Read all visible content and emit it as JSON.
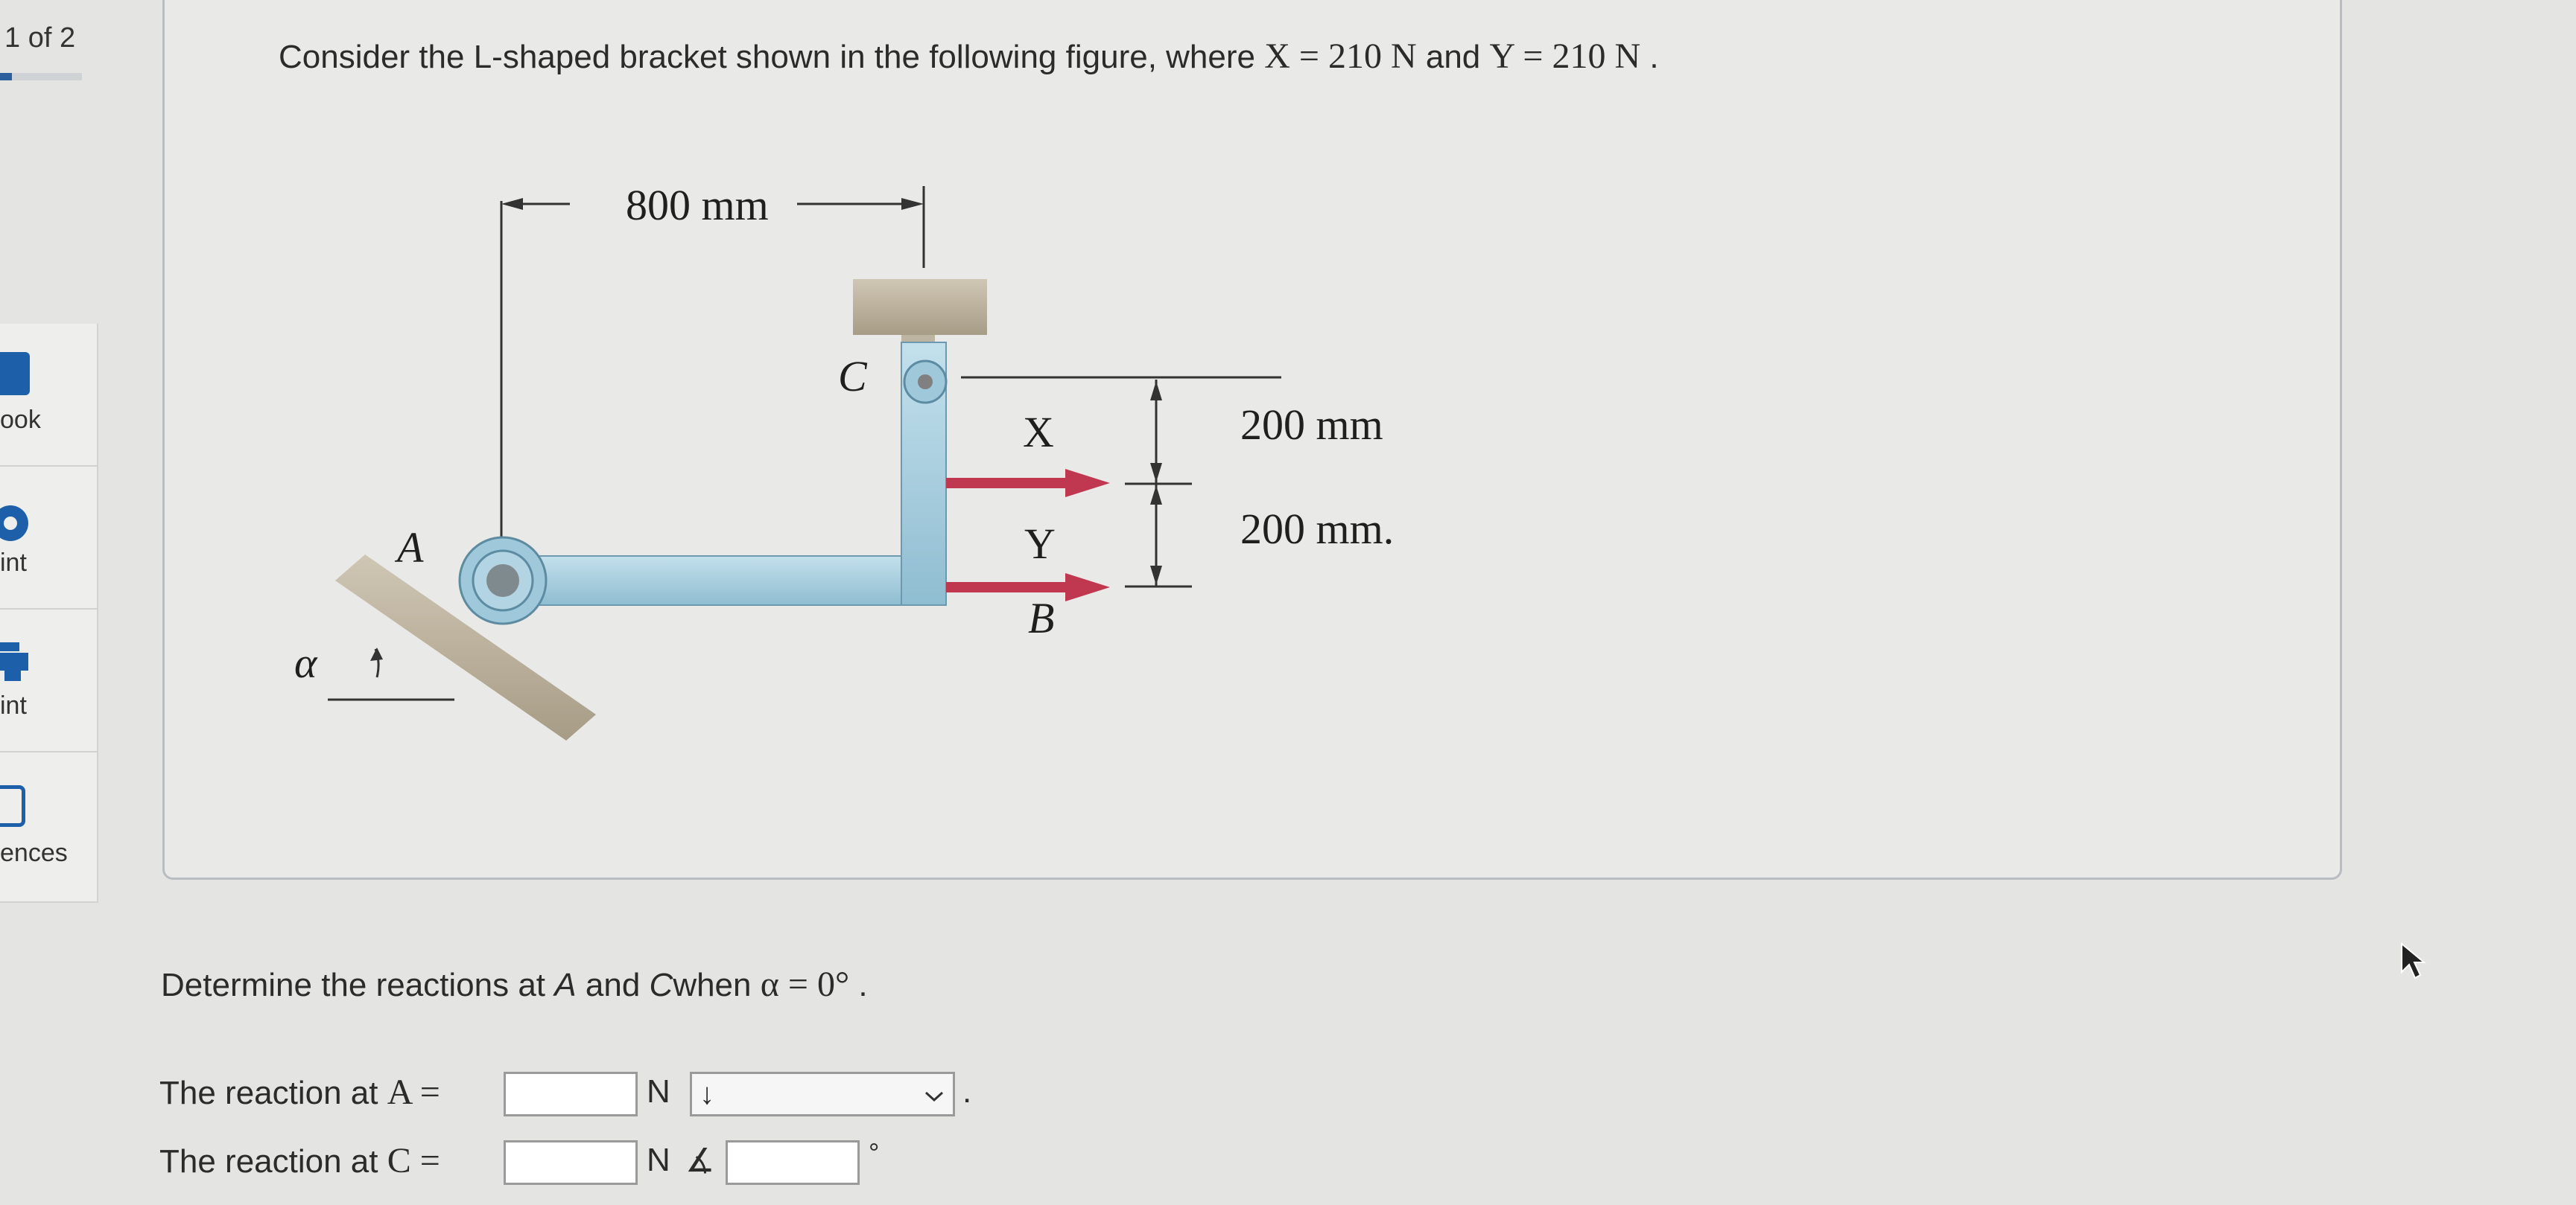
{
  "sidebar": {
    "page_count": "1 of 2",
    "items": [
      {
        "label": "ook",
        "icon": "book-icon"
      },
      {
        "label": "int",
        "icon": "hint-icon"
      },
      {
        "label": "int",
        "icon": "print-icon"
      },
      {
        "label": "ences",
        "icon": "references-icon"
      }
    ]
  },
  "question": {
    "intro": "Consider the L-shaped bracket shown in the following figure, where",
    "x_expr": "X = 210 N",
    "and": "and",
    "y_expr": "Y = 210 N",
    "period": "."
  },
  "figure": {
    "dim_top": "800 mm",
    "dim_upper": "200 mm",
    "dim_lower": "200 mm",
    "dim_lower_period": ".",
    "label_A": "A",
    "label_B": "B",
    "label_C": "C",
    "label_X": "X",
    "label_Y": "Y",
    "label_alpha": "α",
    "arrow_color": "#c0384f",
    "bracket_color": "#a8cfe0"
  },
  "prompt": {
    "text_before": "Determine the reactions at",
    "A": "A",
    "and": "and",
    "C": "C",
    "when": "when",
    "alpha_expr": "α = 0°",
    "period": "."
  },
  "answers": {
    "reaction_A_label": "The reaction at",
    "reaction_A_point": "A =",
    "reaction_A_value": "",
    "reaction_A_unit": "N",
    "reaction_A_direction": "↓",
    "reaction_A_period": ".",
    "reaction_C_label": "The reaction at",
    "reaction_C_point": "C =",
    "reaction_C_value": "",
    "reaction_C_unit": "N",
    "reaction_C_angle_symbol": "∡",
    "reaction_C_angle_value": "",
    "reaction_C_degree": "°"
  }
}
